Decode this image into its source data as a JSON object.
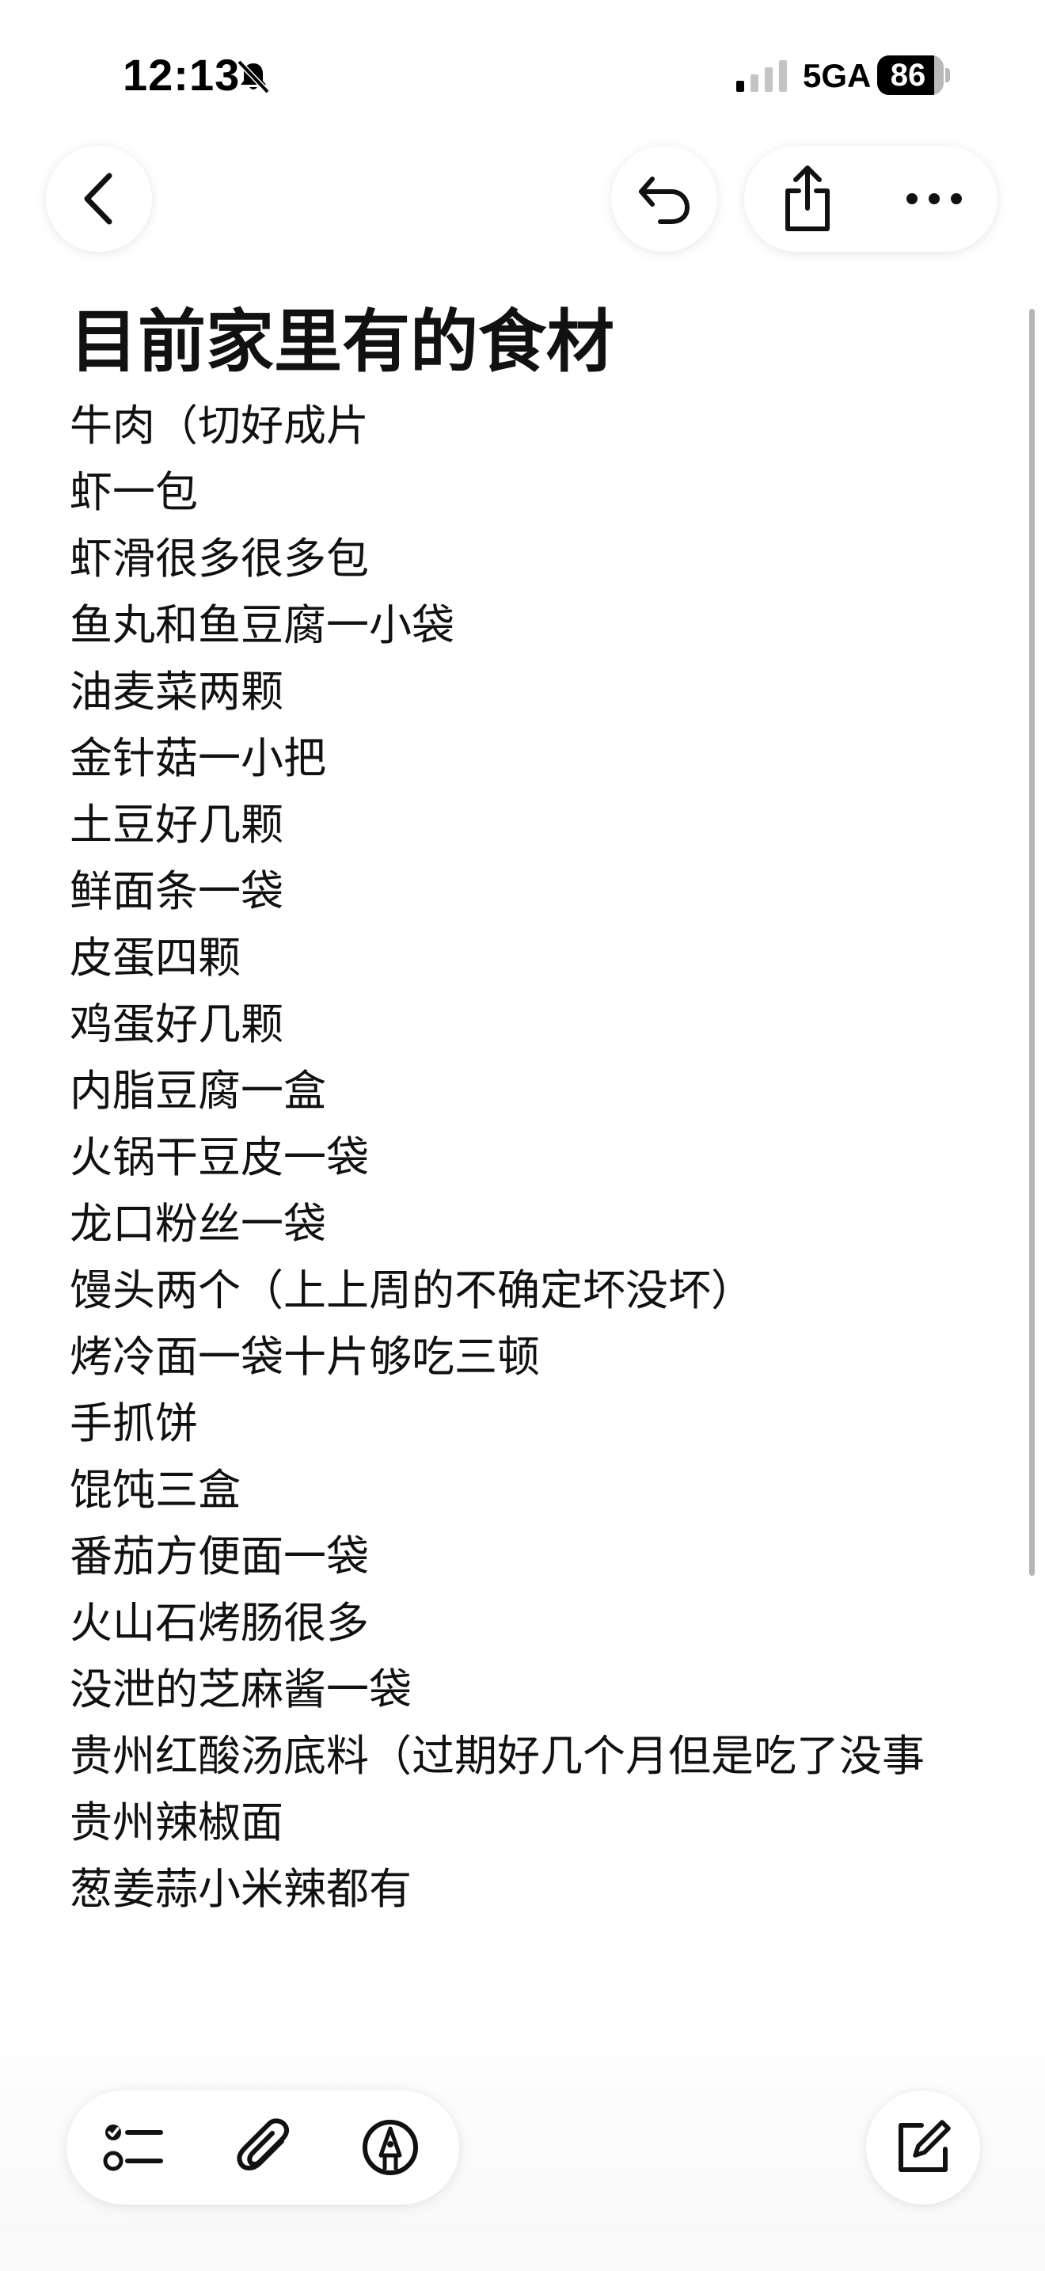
{
  "status_bar": {
    "time": "12:13",
    "network": "5GA",
    "battery_percent": 86
  },
  "toolbar": {
    "back_icon": "chevron-left-icon",
    "undo_icon": "undo-icon",
    "share_icon": "share-icon",
    "more_icon": "ellipsis-icon"
  },
  "note": {
    "title": "目前家里有的食材",
    "lines": [
      "牛肉（切好成片",
      "虾一包",
      "虾滑很多很多包",
      "鱼丸和鱼豆腐一小袋",
      "油麦菜两颗",
      "金针菇一小把",
      "土豆好几颗",
      "鲜面条一袋",
      "皮蛋四颗",
      "鸡蛋好几颗",
      "内脂豆腐一盒",
      "火锅干豆皮一袋",
      "龙口粉丝一袋",
      "馒头两个（上上周的不确定坏没坏）",
      "烤冷面一袋十片够吃三顿",
      "手抓饼",
      "馄饨三盒",
      "番茄方便面一袋",
      "火山石烤肠很多",
      "没泄的芝麻酱一袋",
      "贵州红酸汤底料（过期好几个月但是吃了没事",
      "贵州辣椒面",
      "葱姜蒜小米辣都有"
    ]
  },
  "bottom_toolbar": {
    "checklist_icon": "checklist-icon",
    "attach_icon": "paperclip-icon",
    "markup_icon": "markup-pen-icon",
    "compose_icon": "compose-icon"
  }
}
